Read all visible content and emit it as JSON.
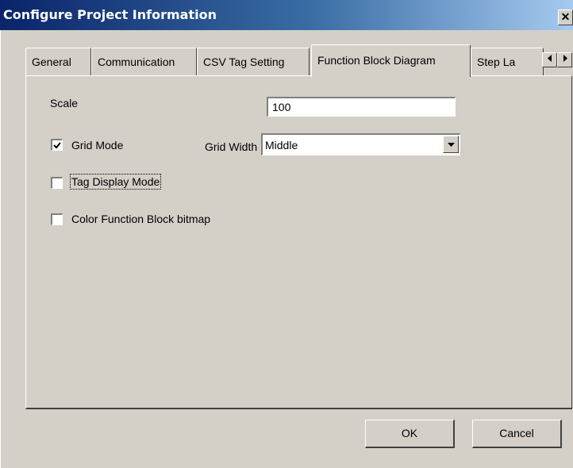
{
  "window": {
    "title": "Configure Project Information",
    "close_glyph": "✕"
  },
  "tabs": [
    {
      "label": "General",
      "active": false
    },
    {
      "label": "Communication",
      "active": false
    },
    {
      "label": "CSV Tag Setting",
      "active": false
    },
    {
      "label": "Function Block Diagram",
      "active": true
    },
    {
      "label": "Step La",
      "active": false
    }
  ],
  "tab_scroll": {
    "left_icon": "arrow-left-icon",
    "right_icon": "arrow-right-icon"
  },
  "form": {
    "scale_label": "Scale",
    "scale_value": "100",
    "grid_mode_label": "Grid Mode",
    "grid_mode_checked": true,
    "grid_width_label": "Grid Width",
    "grid_width_value": "Middle",
    "tag_display_label": "Tag Display Mode",
    "tag_display_checked": false,
    "color_fb_label": "Color Function Block bitmap",
    "color_fb_checked": false
  },
  "buttons": {
    "ok": "OK",
    "cancel": "Cancel"
  }
}
